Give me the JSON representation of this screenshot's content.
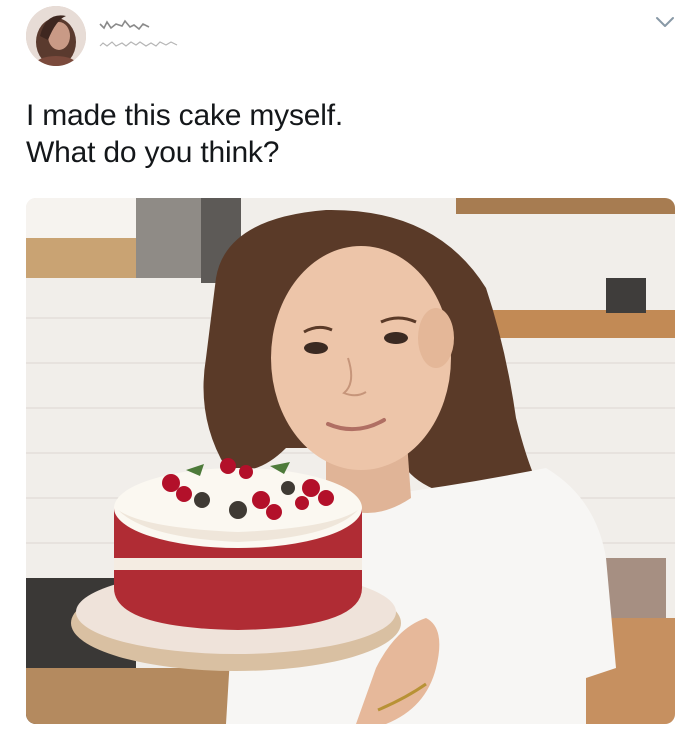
{
  "tweet": {
    "text_lines": [
      "I made this cake myself.",
      "What do you think?"
    ]
  },
  "icons": {
    "menu": "chevron-down-icon"
  },
  "colors": {
    "text": "#14171a",
    "icon": "#8899a6",
    "background": "#ffffff"
  }
}
